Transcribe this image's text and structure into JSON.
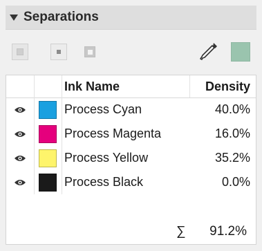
{
  "panel": {
    "title": "Separations"
  },
  "toolbar": {
    "modes": [
      "separation-mode-1",
      "separation-mode-2",
      "separation-mode-3"
    ],
    "eyedropper_icon": "eyedropper-icon",
    "current_color": "#9ac4ae"
  },
  "table": {
    "headers": {
      "name": "Ink Name",
      "density": "Density"
    },
    "rows": [
      {
        "name": "Process Cyan",
        "density": "40.0%",
        "color": "#1aa0e0"
      },
      {
        "name": "Process Magenta",
        "density": "16.0%",
        "color": "#e5007d"
      },
      {
        "name": "Process Yellow",
        "density": "35.2%",
        "color": "#fef46b"
      },
      {
        "name": "Process Black",
        "density": "0.0%",
        "color": "#1a1a1a"
      }
    ]
  },
  "total": {
    "symbol": "∑",
    "value": "91.2%"
  }
}
